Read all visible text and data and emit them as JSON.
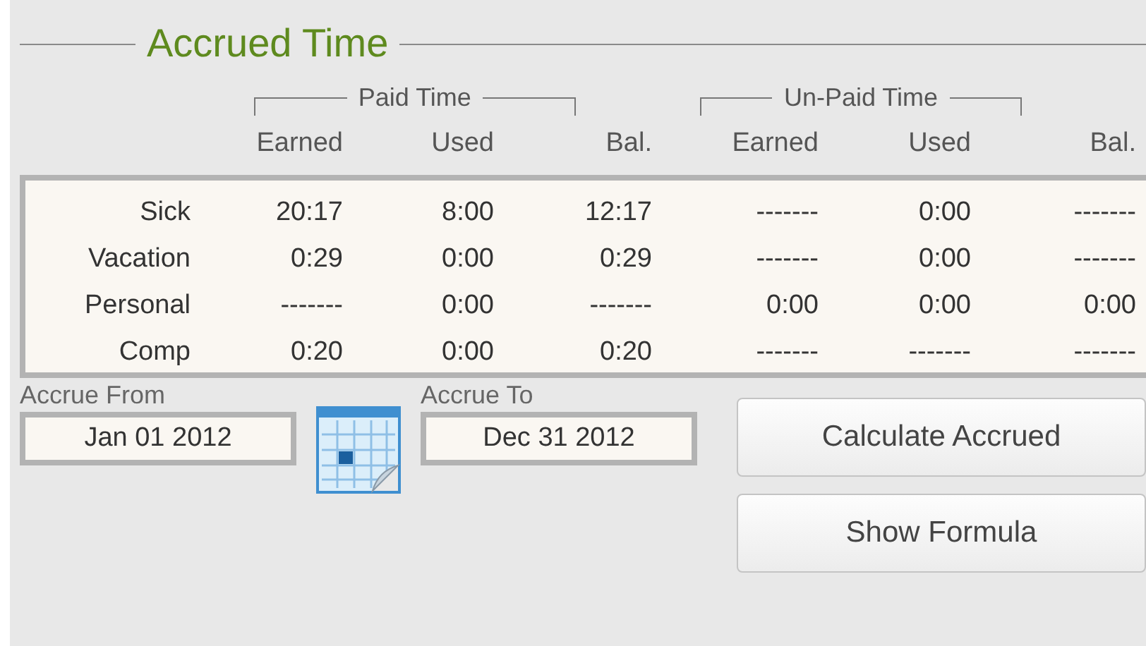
{
  "section": {
    "title": "Accrued Time"
  },
  "column_groups": [
    {
      "label": "Paid Time"
    },
    {
      "label": "Un-Paid Time"
    }
  ],
  "columns": [
    "Earned",
    "Used",
    "Bal.",
    "Earned",
    "Used",
    "Bal."
  ],
  "rows": [
    {
      "label": "Sick",
      "cells": [
        "20:17",
        "8:00",
        "12:17",
        "-------",
        "0:00",
        "-------"
      ]
    },
    {
      "label": "Vacation",
      "cells": [
        "0:29",
        "0:00",
        "0:29",
        "-------",
        "0:00",
        "-------"
      ]
    },
    {
      "label": "Personal",
      "cells": [
        "-------",
        "0:00",
        "-------",
        "0:00",
        "0:00",
        "0:00"
      ]
    },
    {
      "label": "Comp",
      "cells": [
        "0:20",
        "0:00",
        "0:20",
        "-------",
        "-------",
        "-------"
      ]
    }
  ],
  "date_fields": [
    {
      "label": "Accrue From",
      "value": "Jan 01 2012"
    },
    {
      "label": "Accrue To",
      "value": "Dec 31 2012"
    }
  ],
  "buttons": [
    "Calculate Accrued",
    "Show Formula"
  ]
}
